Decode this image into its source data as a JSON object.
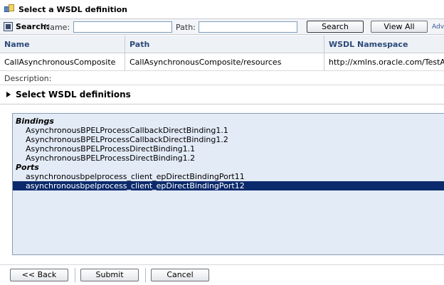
{
  "window": {
    "title": "Select a WSDL definition",
    "icon": "wsdl-dialog-icon"
  },
  "search": {
    "label": "Search:",
    "name_label": "Name:",
    "name_value": "",
    "path_label": "Path:",
    "path_value": "",
    "search_button": "Search",
    "view_all_button": "View All",
    "advanced_link": "Adv"
  },
  "table": {
    "headers": [
      "Name",
      "Path",
      "WSDL Namespace"
    ],
    "rows": [
      [
        "CallAsynchronousComposite",
        "CallAsynchronousComposite/resources",
        "http://xmlns.oracle.com/TestApplicat"
      ]
    ]
  },
  "description": {
    "label": "Description:"
  },
  "section": {
    "title": "Select WSDL definitions"
  },
  "list": {
    "groups": [
      {
        "label": "Bindings",
        "options": [
          "AsynchronousBPELProcessCallbackDirectBinding1.1",
          "AsynchronousBPELProcessCallbackDirectBinding1.2",
          "AsynchronousBPELProcessDirectBinding1.1",
          "AsynchronousBPELProcessDirectBinding1.2"
        ]
      },
      {
        "label": "Ports",
        "options": [
          "asynchronousbpelprocess_client_epDirectBindingPort11",
          "asynchronousbpelprocess_client_epDirectBindingPort12"
        ]
      }
    ],
    "selected": "asynchronousbpelprocess_client_epDirectBindingPort12"
  },
  "footer": {
    "back": "<< Back",
    "submit": "Submit",
    "cancel": "Cancel"
  },
  "colors": {
    "selection": "#0b2a6b",
    "listbox_bg": "#e3ebf7",
    "header_text": "#2b4a7a"
  }
}
